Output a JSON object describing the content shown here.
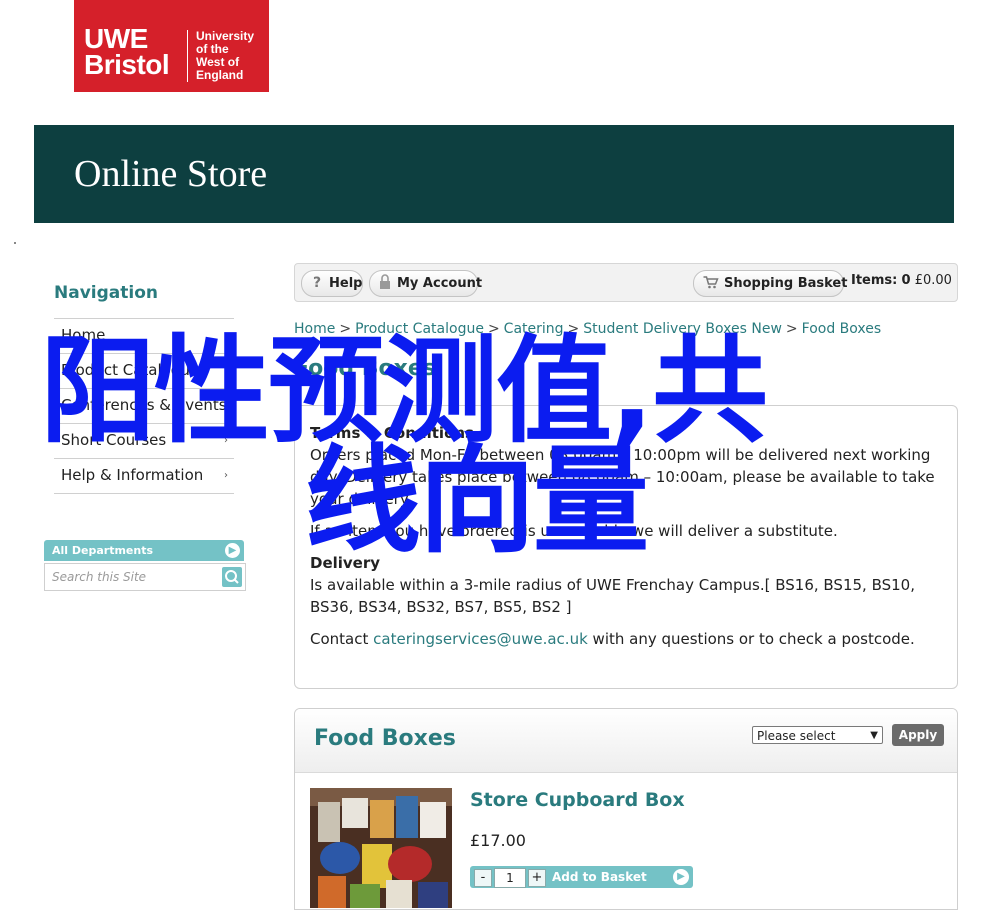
{
  "logo": {
    "line1": "UWE",
    "line2": "Bristol",
    "uni_lines": [
      "University",
      "of the",
      "West of",
      "England"
    ]
  },
  "banner": {
    "title": "Online Store"
  },
  "navigation": {
    "heading": "Navigation",
    "items": [
      {
        "label": "Home",
        "has_arrow": false
      },
      {
        "label": "Product Catalogue",
        "has_arrow": true
      },
      {
        "label": "Conferences & Events",
        "has_arrow": false
      },
      {
        "label": "Short Courses",
        "has_arrow": true
      },
      {
        "label": "Help & Information",
        "has_arrow": true
      }
    ]
  },
  "departments": {
    "label": "All Departments"
  },
  "search": {
    "placeholder": "Search this Site"
  },
  "toolbar": {
    "help": "Help",
    "account": "My Account",
    "basket": "Shopping Basket",
    "items_label": "Items:",
    "items_count": "0",
    "items_total": "£0.00"
  },
  "breadcrumb": [
    "Home",
    "Product Catalogue",
    "Catering",
    "Student Delivery Boxes New",
    "Food Boxes"
  ],
  "section_title": "Food Boxes",
  "terms": {
    "heading": "Terms & Conditions",
    "p1": "Orders placed Mon-Fri between 08:00am – 10:00pm will be delivered next working day. Delivery takes place between 08:00am – 10:00am, please be available to take your delivery.",
    "p2": "If an item you have ordered is unavailable we will deliver a substitute.",
    "delivery_heading": "Delivery",
    "p3": "Is available within a 3-mile radius of UWE Frenchay Campus.[ BS16, BS15, BS10, BS36, BS34, BS32, BS7, BS5, BS2 ]",
    "contact_pre": "Contact ",
    "contact_email": "cateringservices@uwe.ac.uk",
    "contact_post": " with any questions or to check a postcode."
  },
  "listing": {
    "title": "Food Boxes",
    "sort_selected": "Please select",
    "apply": "Apply",
    "products": [
      {
        "name": "Store Cupboard Box",
        "price": "£17.00",
        "qty": "1",
        "add_label": "Add to Basket"
      }
    ]
  },
  "overlay": {
    "line1": "阳性预测值,共",
    "line2": "线向量"
  },
  "colors": {
    "brand_red": "#d5202a",
    "banner_teal": "#0d3f40",
    "accent_teal": "#2a7b7e",
    "button_teal": "#74c2c6",
    "overlay_blue": "#0b1cf0"
  }
}
